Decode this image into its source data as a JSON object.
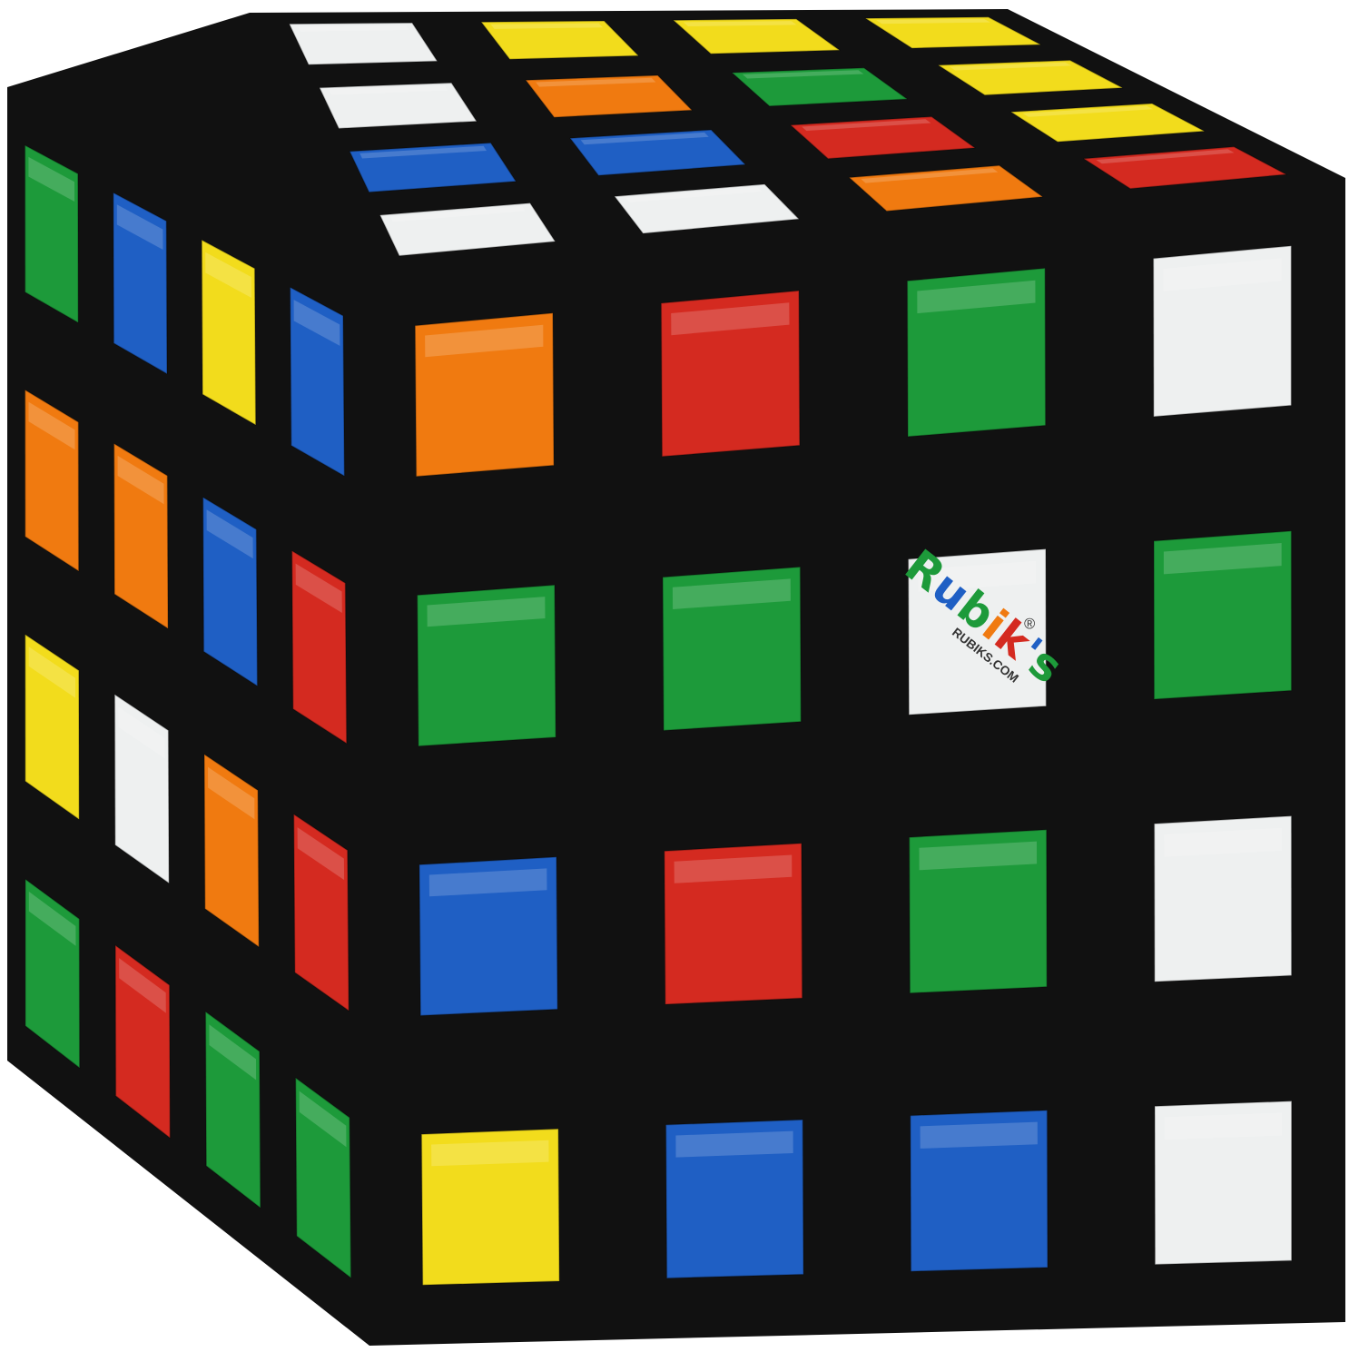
{
  "colors": {
    "white": "#eef0f0",
    "yellow": "#f2dc1c",
    "orange": "#f07a10",
    "red": "#d42a20",
    "green": "#1d9a3a",
    "blue": "#1f5fc4",
    "body": "#111111",
    "background": "#ffffff"
  },
  "cube": {
    "size": "4x4",
    "faces": {
      "top": [
        [
          "white",
          "yellow",
          "yellow",
          "yellow"
        ],
        [
          "white",
          "orange",
          "green",
          "yellow"
        ],
        [
          "blue",
          "blue",
          "red",
          "yellow"
        ],
        [
          "white",
          "white",
          "orange",
          "red"
        ]
      ],
      "left": [
        [
          "green",
          "blue",
          "yellow",
          "blue"
        ],
        [
          "orange",
          "orange",
          "blue",
          "red"
        ],
        [
          "yellow",
          "white",
          "orange",
          "red"
        ],
        [
          "green",
          "red",
          "green",
          "green"
        ]
      ],
      "front": [
        [
          "orange",
          "red",
          "green",
          "white"
        ],
        [
          "green",
          "green",
          "logo",
          "green"
        ],
        [
          "blue",
          "red",
          "green",
          "white"
        ],
        [
          "yellow",
          "blue",
          "blue",
          "white"
        ]
      ]
    }
  },
  "logo": {
    "wordmark": "Rubik's",
    "registered": "®",
    "url": "RUBIKS.COM",
    "letter_colors": [
      "#1d9a3a",
      "#1f5fc4",
      "#1d9a3a",
      "#f07a10",
      "#d42a20",
      "#1f5fc4",
      "#1d9a3a"
    ]
  }
}
